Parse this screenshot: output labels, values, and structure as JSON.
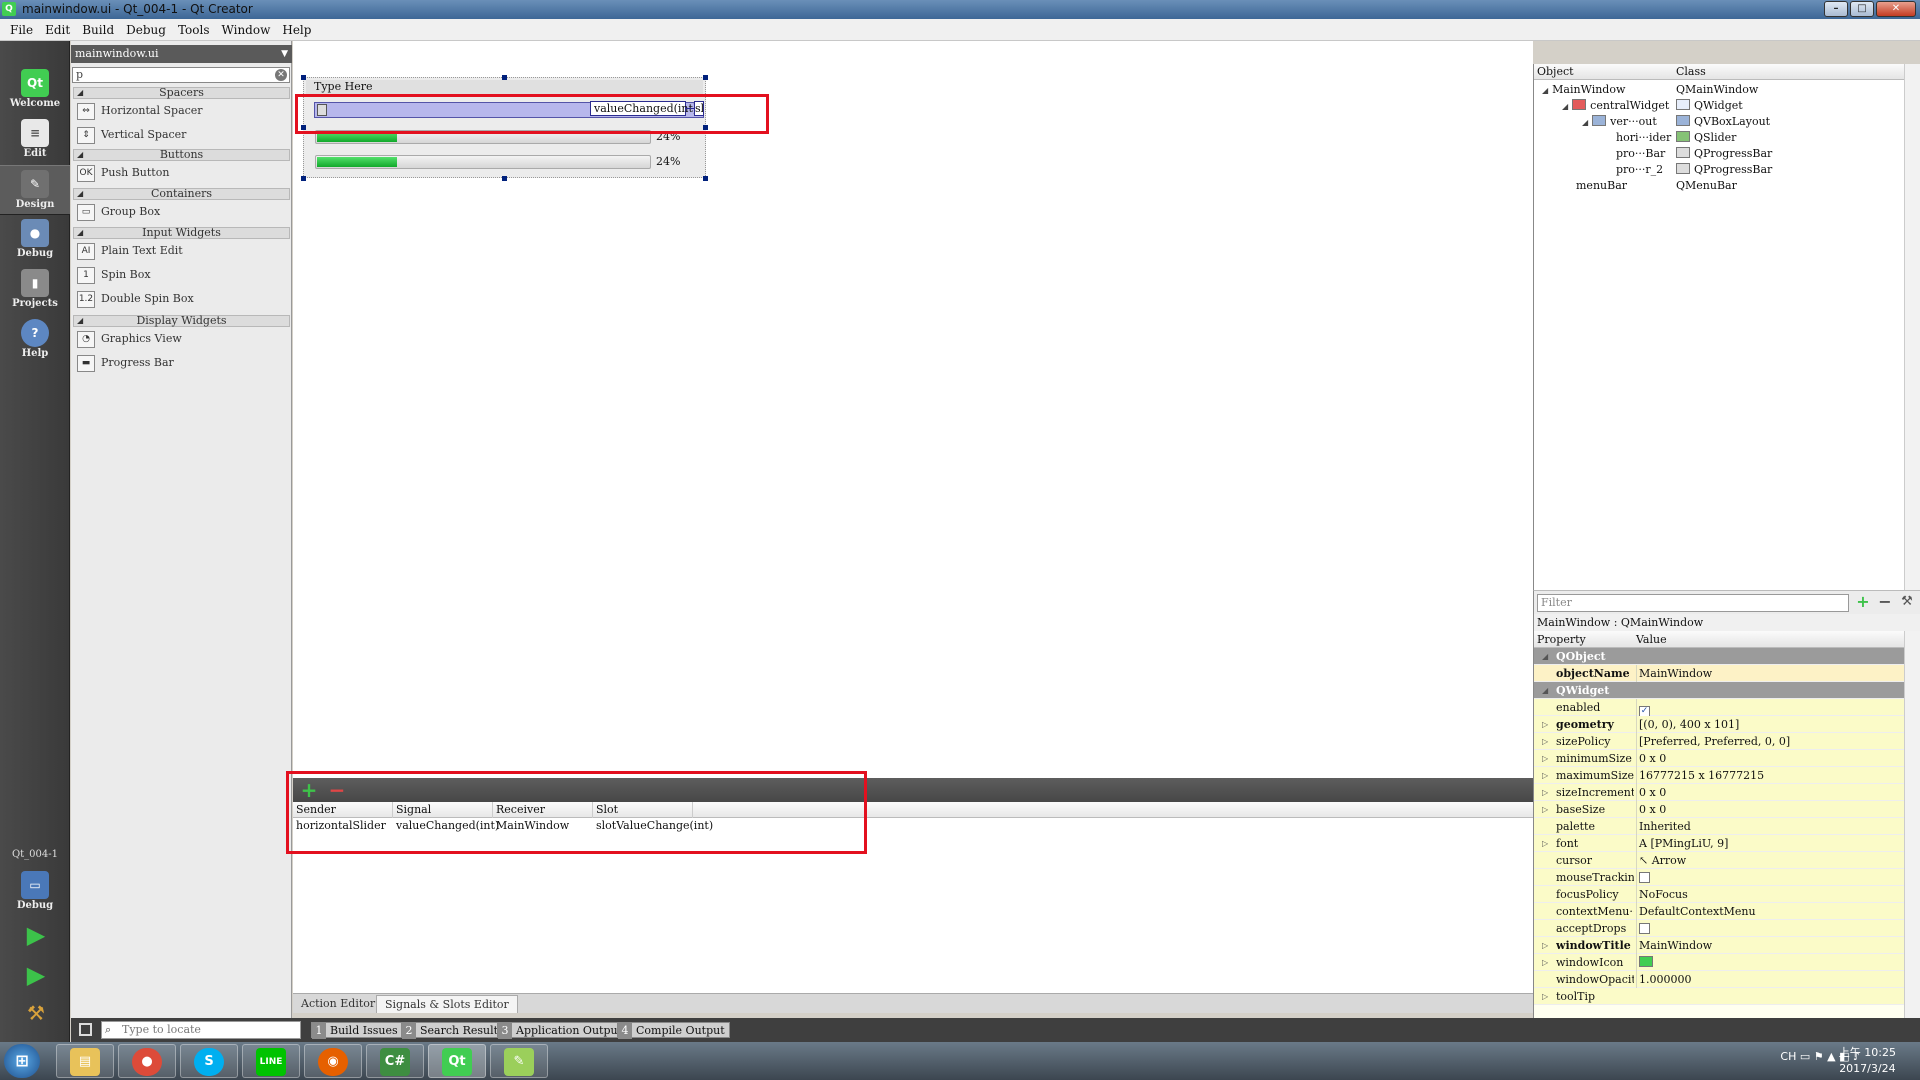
{
  "window": {
    "title": "mainwindow.ui - Qt_004-1 - Qt Creator",
    "minimize": "–",
    "maximize": "□",
    "close": "✕"
  },
  "menubar": [
    "File",
    "Edit",
    "Build",
    "Debug",
    "Tools",
    "Window",
    "Help"
  ],
  "modes": [
    {
      "label": "Welcome",
      "icon": "qt-logo-icon"
    },
    {
      "label": "Edit",
      "icon": "document-icon"
    },
    {
      "label": "Design",
      "icon": "pencil-icon",
      "active": true
    },
    {
      "label": "Debug",
      "icon": "bug-icon"
    },
    {
      "label": "Projects",
      "icon": "wrench-book-icon"
    },
    {
      "label": "Help",
      "icon": "help-icon"
    }
  ],
  "kit": {
    "project": "Qt_004-1",
    "mode": "Debug"
  },
  "widget_box": {
    "file_combo": "mainwindow.ui",
    "filter_value": "p",
    "categories": {
      "spacers": "Spacers",
      "buttons": "Buttons",
      "containers": "Containers",
      "input": "Input Widgets",
      "display": "Display Widgets"
    },
    "items": {
      "horizontal_spacer": "Horizontal Spacer",
      "vertical_spacer": "Vertical Spacer",
      "push_button": "Push Button",
      "group_box": "Group Box",
      "plain_text_edit": "Plain Text Edit",
      "spin_box": "Spin Box",
      "double_spin_box": "Double Spin Box",
      "graphics_view": "Graphics View",
      "progress_bar": "Progress Bar"
    },
    "icon_glyphs": {
      "push_button": "OK",
      "plain_text_edit": "AI",
      "spin_box": "1",
      "double_spin_box": "1.2"
    }
  },
  "form": {
    "menu_placeholder": "Type Here",
    "signal_label": "valueChanged(int)",
    "slot_label_partial": "sl",
    "progress_bars": [
      {
        "value": 24,
        "text": "24%"
      },
      {
        "value": 24,
        "text": "24%"
      }
    ]
  },
  "signals_slots": {
    "add": "+",
    "remove": "−",
    "headers": {
      "sender": "Sender",
      "signal": "Signal",
      "receiver": "Receiver",
      "slot": "Slot"
    },
    "rows": [
      {
        "sender": "horizontalSlider",
        "signal": "valueChanged(int)",
        "receiver": "MainWindow",
        "slot": "slotValueChange(int)"
      }
    ]
  },
  "editor_tabs": {
    "action_editor": "Action Editor",
    "signals_slots": "Signals & Slots Editor"
  },
  "object_inspector": {
    "headers": {
      "object": "Object",
      "class": "Class"
    },
    "rows": [
      {
        "object": "MainWindow",
        "class": "QMainWindow"
      },
      {
        "object": "centralWidget",
        "class": "QWidget"
      },
      {
        "object": "ver···out",
        "class": "QVBoxLayout"
      },
      {
        "object": "hori···ider",
        "class": "QSlider"
      },
      {
        "object": "pro···Bar",
        "class": "QProgressBar"
      },
      {
        "object": "pro···r_2",
        "class": "QProgressBar"
      },
      {
        "object": "menuBar",
        "class": "QMenuBar"
      }
    ]
  },
  "property_editor": {
    "filter_placeholder": "Filter",
    "add": "+",
    "remove": "−",
    "configure": "⚒",
    "title": "MainWindow : QMainWindow",
    "headers": {
      "property": "Property",
      "value": "Value"
    },
    "groups": {
      "qobject": "QObject",
      "qwidget": "QWidget"
    },
    "properties": {
      "objectName": {
        "name": "objectName",
        "value": "MainWindow"
      },
      "enabled": {
        "name": "enabled",
        "value": "✓"
      },
      "geometry": {
        "name": "geometry",
        "value": "[(0, 0), 400 x 101]"
      },
      "sizePolicy": {
        "name": "sizePolicy",
        "value": "[Preferred, Preferred, 0, 0]"
      },
      "minimumSize": {
        "name": "minimumSize",
        "value": "0 x 0"
      },
      "maximumSize": {
        "name": "maximumSize",
        "value": "16777215 x 16777215"
      },
      "sizeIncrement": {
        "name": "sizeIncrement",
        "value": "0 x 0"
      },
      "baseSize": {
        "name": "baseSize",
        "value": "0 x 0"
      },
      "palette": {
        "name": "palette",
        "value": "Inherited"
      },
      "font": {
        "name": "font",
        "value": "A  [PMingLiU, 9]"
      },
      "cursor": {
        "name": "cursor",
        "value": "Arrow"
      },
      "mouseTracking": {
        "name": "mouseTracking",
        "value": ""
      },
      "focusPolicy": {
        "name": "focusPolicy",
        "value": "NoFocus"
      },
      "contextMenu": {
        "name": "contextMenu···",
        "value": "DefaultContextMenu"
      },
      "acceptDrops": {
        "name": "acceptDrops",
        "value": ""
      },
      "windowTitle": {
        "name": "windowTitle",
        "value": "MainWindow"
      },
      "windowIcon": {
        "name": "windowIcon",
        "value": ""
      },
      "windowOpacity": {
        "name": "windowOpacity",
        "value": "1.000000"
      },
      "toolTip": {
        "name": "toolTip",
        "value": ""
      }
    }
  },
  "statusbar": {
    "locator_placeholder": "Type to locate",
    "output_tabs": [
      {
        "n": "1",
        "label": "Build Issues"
      },
      {
        "n": "2",
        "label": "Search Results"
      },
      {
        "n": "3",
        "label": "Application Output"
      },
      {
        "n": "4",
        "label": "Compile Output"
      }
    ]
  },
  "taskbar": {
    "apps": [
      "explorer",
      "chrome",
      "skype",
      "line",
      "firefox",
      "csharp",
      "qt-creator",
      "notepad"
    ],
    "app_labels": {
      "skype": "S",
      "line": "LINE",
      "csharp": "C#",
      "qt": "Qt"
    },
    "tray": "CH",
    "time": "上午 10:25",
    "date": "2017/3/24"
  },
  "colors": {
    "highlight_box": "#e3101f",
    "progress_fill": "#11a92b",
    "run_green": "#3cc24a"
  }
}
